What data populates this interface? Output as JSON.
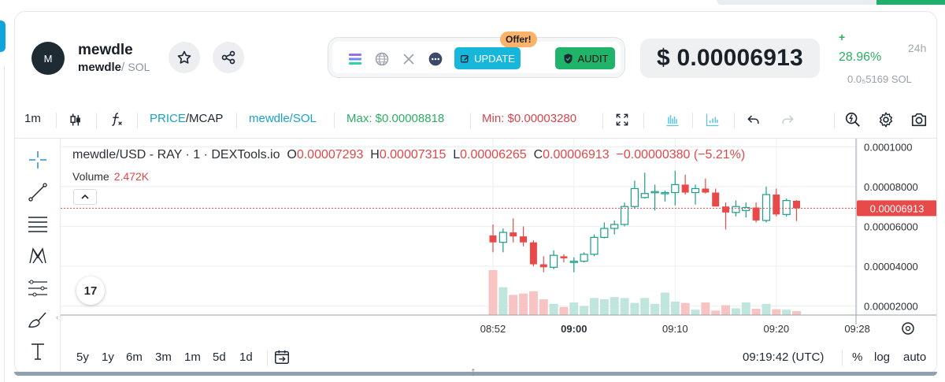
{
  "header": {
    "avatar_letter": "M",
    "token_name": "mewdle",
    "pair_base": "mewdle",
    "pair_sep": "/",
    "pair_quote": "SOL",
    "update_label": "UPDATE",
    "offer_label": "Offer!",
    "audit_label": "AUDIT",
    "price": "$ 0.00006913",
    "change_sign": "+",
    "change_pct": "28.96%",
    "change_period": "24h",
    "sol_price": "0.0₅5169 SOL"
  },
  "toolbar": {
    "interval": "1m",
    "price_label": "PRICE",
    "mcap_label": "/MCAP",
    "pair": "mewdle/SOL",
    "max_label": "Max: $0.00008818",
    "min_label": "Min: $0.00003280"
  },
  "legend": {
    "symbol": "mewdle/USD - RAY · 1 · DEXTools.io",
    "o_key": "O",
    "o_val": "0.00007293",
    "h_key": "H",
    "h_val": "0.00007315",
    "l_key": "L",
    "l_val": "0.00006265",
    "c_key": "C",
    "c_val": "0.00006913",
    "change": "−0.00000380 (−5.21%)",
    "volume_label": "Volume",
    "volume_value": "2.472K",
    "tv_logo": "17"
  },
  "bottom": {
    "ranges": [
      "5y",
      "1y",
      "6m",
      "3m",
      "1m",
      "5d",
      "1d"
    ],
    "time": "09:19:42 (UTC)",
    "percent": "%",
    "log": "log",
    "auto": "auto"
  },
  "chart_data": {
    "type": "candlestick",
    "y_ticks": [
      "0.0001000",
      "0.00008000",
      "0.00006000",
      "0.00004000",
      "0.00002000"
    ],
    "y_tick_values": [
      0.0001,
      8e-05,
      6e-05,
      4e-05,
      2e-05
    ],
    "ylim": [
      1.55e-05,
      0.0001033
    ],
    "x_ticks": [
      {
        "label": "08:52",
        "minute": 0,
        "bold": false
      },
      {
        "label": "09:00",
        "minute": 8,
        "bold": true
      },
      {
        "label": "09:10",
        "minute": 18,
        "bold": false
      },
      {
        "label": "09:20",
        "minute": 28,
        "bold": false
      },
      {
        "label": "09:28",
        "minute": 36,
        "bold": false
      }
    ],
    "current_price": 6.913e-05,
    "current_price_label": "0.00006913",
    "up_color": "#1a9e8a",
    "down_color": "#e84a4a",
    "candles": [
      {
        "o": 5.55e-05,
        "h": 6.1e-05,
        "l": 4.7e-05,
        "c": 5.2e-05,
        "v": 1.0
      },
      {
        "o": 5.2e-05,
        "h": 5.9e-05,
        "l": 4.7e-05,
        "c": 5.7e-05,
        "v": 0.62
      },
      {
        "o": 5.7e-05,
        "h": 6.4e-05,
        "l": 5.2e-05,
        "c": 5.5e-05,
        "v": 0.45
      },
      {
        "o": 5.5e-05,
        "h": 6e-05,
        "l": 5e-05,
        "c": 5.2e-05,
        "v": 0.48
      },
      {
        "o": 5.2e-05,
        "h": 5.3e-05,
        "l": 4e-05,
        "c": 4.1e-05,
        "v": 0.53
      },
      {
        "o": 4.1e-05,
        "h": 4.5e-05,
        "l": 3.7e-05,
        "c": 3.95e-05,
        "v": 0.35
      },
      {
        "o": 3.95e-05,
        "h": 4.8e-05,
        "l": 3.85e-05,
        "c": 4.55e-05,
        "v": 0.25
      },
      {
        "o": 4.5e-05,
        "h": 4.6e-05,
        "l": 4.2e-05,
        "c": 4.4e-05,
        "v": 0.18
      },
      {
        "o": 4.2e-05,
        "h": 4.45e-05,
        "l": 3.7e-05,
        "c": 4.25e-05,
        "v": 0.28
      },
      {
        "o": 4.25e-05,
        "h": 4.7e-05,
        "l": 4.2e-05,
        "c": 4.6e-05,
        "v": 0.2
      },
      {
        "o": 4.6e-05,
        "h": 5.6e-05,
        "l": 4.5e-05,
        "c": 5.45e-05,
        "v": 0.38
      },
      {
        "o": 5.45e-05,
        "h": 6.2e-05,
        "l": 5.4e-05,
        "c": 5.9e-05,
        "v": 0.35
      },
      {
        "o": 5.9e-05,
        "h": 6.3e-05,
        "l": 5.6e-05,
        "c": 6.1e-05,
        "v": 0.4
      },
      {
        "o": 6.1e-05,
        "h": 7.2e-05,
        "l": 6e-05,
        "c": 7e-05,
        "v": 0.38
      },
      {
        "o": 7e-05,
        "h": 8.3e-05,
        "l": 6.9e-05,
        "c": 7.9e-05,
        "v": 0.27
      },
      {
        "o": 7.45e-05,
        "h": 8.7e-05,
        "l": 7.4e-05,
        "c": 7.65e-05,
        "v": 0.38
      },
      {
        "o": 7.7e-05,
        "h": 8.1e-05,
        "l": 6.8e-05,
        "c": 7.75e-05,
        "v": 0.25
      },
      {
        "o": 7.65e-05,
        "h": 7.8e-05,
        "l": 7.25e-05,
        "c": 7.7e-05,
        "v": 0.5
      },
      {
        "o": 7.7e-05,
        "h": 8.8e-05,
        "l": 7.05e-05,
        "c": 8.1e-05,
        "v": 0.3
      },
      {
        "o": 8.1e-05,
        "h": 8.6e-05,
        "l": 7.6e-05,
        "c": 7.7e-05,
        "v": 0.27
      },
      {
        "o": 7.7e-05,
        "h": 8.1e-05,
        "l": 7.1e-05,
        "c": 7.9e-05,
        "v": 0.12
      },
      {
        "o": 7.9e-05,
        "h": 8.4e-05,
        "l": 7.65e-05,
        "c": 7.7e-05,
        "v": 0.28
      },
      {
        "o": 7.7e-05,
        "h": 7.9e-05,
        "l": 7e-05,
        "c": 7e-05,
        "v": 0.1
      },
      {
        "o": 7e-05,
        "h": 7.2e-05,
        "l": 5.85e-05,
        "c": 6.7e-05,
        "v": 0.22
      },
      {
        "o": 6.7e-05,
        "h": 7.3e-05,
        "l": 6.5e-05,
        "c": 7e-05,
        "v": 0.15
      },
      {
        "o": 6.8e-05,
        "h": 7.2e-05,
        "l": 6.45e-05,
        "c": 6.95e-05,
        "v": 0.28
      },
      {
        "o": 6.95e-05,
        "h": 7.2e-05,
        "l": 6.2e-05,
        "c": 6.3e-05,
        "v": 0.14
      },
      {
        "o": 6.3e-05,
        "h": 8e-05,
        "l": 6.2e-05,
        "c": 7.6e-05,
        "v": 0.25
      },
      {
        "o": 7.6e-05,
        "h": 7.9e-05,
        "l": 6.5e-05,
        "c": 6.6e-05,
        "v": 0.13
      },
      {
        "o": 6.6e-05,
        "h": 7.4e-05,
        "l": 6.5e-05,
        "c": 7.3e-05,
        "v": 0.12
      },
      {
        "o": 7.29e-05,
        "h": 7.32e-05,
        "l": 6.27e-05,
        "c": 6.91e-05,
        "v": 0.09
      }
    ]
  }
}
